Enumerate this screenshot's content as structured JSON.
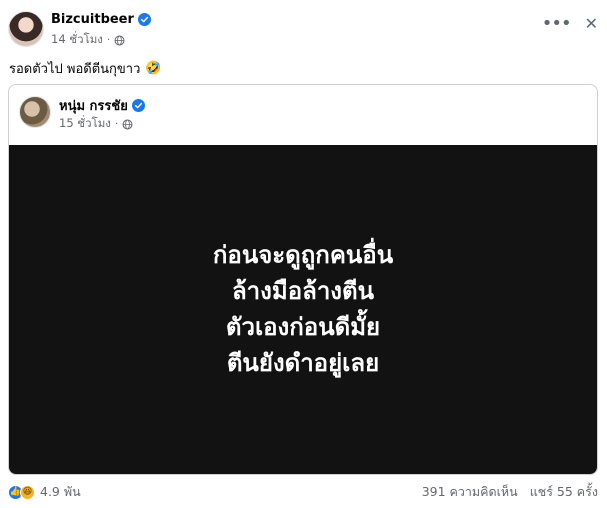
{
  "post": {
    "author": "Bizcuitbeer",
    "time": "14 ชั่วโมง",
    "caption": "รอดตัวไป พอดีตีนกุขาว",
    "caption_emoji": "🤣"
  },
  "shared_post": {
    "author": "หนุ่ม กรรชัย",
    "time": "15 ชั่วโมง",
    "text_lines": [
      "ก่อนจะดูถูกคนอื่น",
      "ล้างมือล้างตีน",
      "ตัวเองก่อนดีมั้ย",
      "ตีนยังดำอยู่เลย"
    ]
  },
  "footer": {
    "reaction_count": "4.9 พัน",
    "comments": "391 ความคิดเห็น",
    "shares": "แชร์ 55 ครั้ง"
  },
  "icons": {
    "verified": "verified-badge-icon",
    "globe": "globe-icon",
    "more": "more-options-icon",
    "close": "close-icon",
    "like": "like-reaction-icon",
    "haha": "haha-reaction-icon"
  },
  "colors": {
    "verified_blue": "#1877f2",
    "card_background": "#121212",
    "secondary_text": "#65676b"
  }
}
